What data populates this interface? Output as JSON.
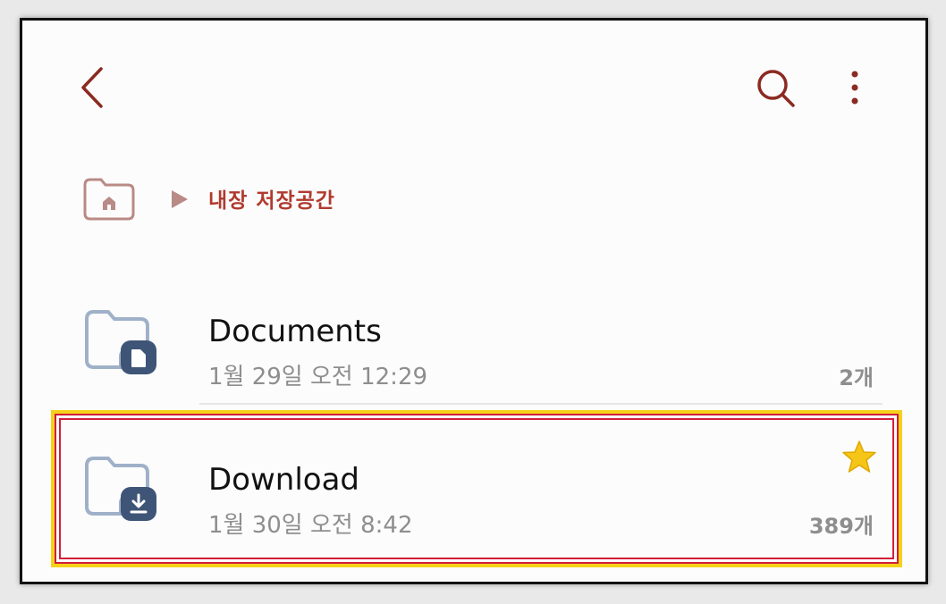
{
  "toolbar": {
    "back_icon": "chevron-left-icon",
    "search_icon": "search-icon",
    "more_icon": "more-vert-icon",
    "accent_color": "#8b2a22"
  },
  "breadcrumb": {
    "home_icon": "home-folder-icon",
    "separator_icon": "triangle-right-icon",
    "label": "내장 저장공간",
    "label_color": "#b03a2e"
  },
  "folders": [
    {
      "name": "Documents",
      "modified": "1월 29일 오전 12:29",
      "count": "2개",
      "badge_icon": "document-icon",
      "starred": false
    },
    {
      "name": "Download",
      "modified": "1월 30일 오전 8:42",
      "count": "389개",
      "badge_icon": "download-icon",
      "starred": true,
      "highlighted": true
    }
  ],
  "colors": {
    "folder_outline": "#9fb1c8",
    "folder_badge": "#3f5577",
    "star": "#f5c518",
    "highlight_outer": "#f5d21a",
    "highlight_inner": "#d11f3a"
  }
}
